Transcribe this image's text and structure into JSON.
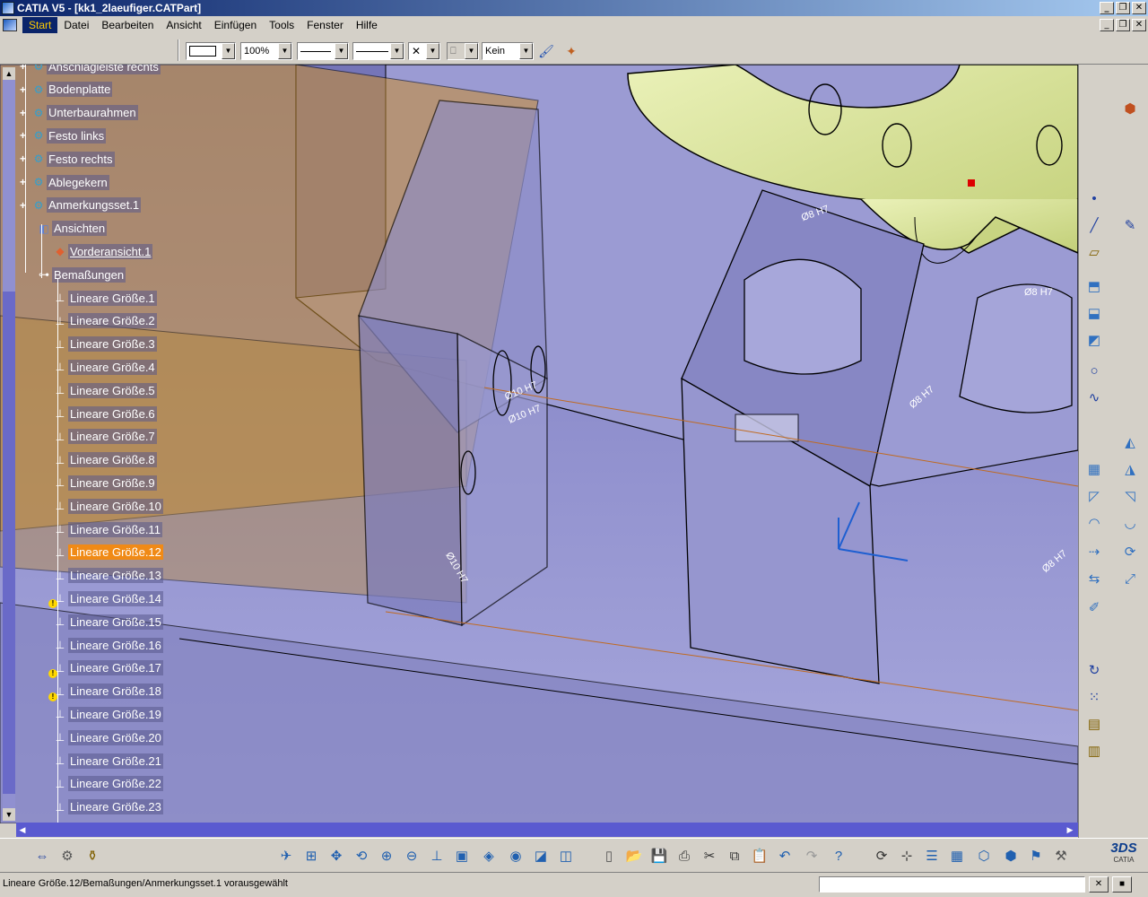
{
  "window": {
    "title": "CATIA V5 - [kk1_2laeufiger.CATPart]"
  },
  "menu": {
    "items": [
      "Start",
      "Datei",
      "Bearbeiten",
      "Ansicht",
      "Einfügen",
      "Tools",
      "Fenster",
      "Hilfe"
    ],
    "active_index": 0
  },
  "toolbar_top": {
    "zoom_value": "100%",
    "layer_value": "Kein"
  },
  "tree": {
    "items": [
      {
        "label": "Anschlagleiste rechts",
        "level": 1,
        "icon": "body-icon"
      },
      {
        "label": "Bodenplatte",
        "level": 1,
        "icon": "body-icon"
      },
      {
        "label": "Unterbaurahmen",
        "level": 1,
        "icon": "body-icon"
      },
      {
        "label": "Festo links",
        "level": 1,
        "icon": "body-icon"
      },
      {
        "label": "Festo rechts",
        "level": 1,
        "icon": "body-icon"
      },
      {
        "label": "Ablegekern",
        "level": 1,
        "icon": "body-icon"
      },
      {
        "label": "Anmerkungsset.1",
        "level": 1,
        "icon": "annotation-set-icon"
      },
      {
        "label": "Ansichten",
        "level": 2,
        "icon": "views-icon"
      },
      {
        "label": "Vorderansicht.1",
        "level": 3,
        "icon": "front-view-icon"
      },
      {
        "label": "Bemaßungen",
        "level": 2,
        "icon": "dimensions-icon"
      },
      {
        "label": "Lineare Größe.1",
        "level": 3,
        "icon": "linear-dimension-icon"
      },
      {
        "label": "Lineare Größe.2",
        "level": 3,
        "icon": "linear-dimension-icon"
      },
      {
        "label": "Lineare Größe.3",
        "level": 3,
        "icon": "linear-dimension-icon"
      },
      {
        "label": "Lineare Größe.4",
        "level": 3,
        "icon": "linear-dimension-icon"
      },
      {
        "label": "Lineare Größe.5",
        "level": 3,
        "icon": "linear-dimension-icon"
      },
      {
        "label": "Lineare Größe.6",
        "level": 3,
        "icon": "linear-dimension-icon"
      },
      {
        "label": "Lineare Größe.7",
        "level": 3,
        "icon": "linear-dimension-icon"
      },
      {
        "label": "Lineare Größe.8",
        "level": 3,
        "icon": "linear-dimension-icon"
      },
      {
        "label": "Lineare Größe.9",
        "level": 3,
        "icon": "linear-dimension-icon"
      },
      {
        "label": "Lineare Größe.10",
        "level": 3,
        "icon": "linear-dimension-icon"
      },
      {
        "label": "Lineare Größe.11",
        "level": 3,
        "icon": "linear-dimension-icon"
      },
      {
        "label": "Lineare Größe.12",
        "level": 3,
        "icon": "linear-dimension-icon",
        "selected": true
      },
      {
        "label": "Lineare Größe.13",
        "level": 3,
        "icon": "linear-dimension-icon"
      },
      {
        "label": "Lineare Größe.14",
        "level": 3,
        "icon": "linear-dimension-warning-icon"
      },
      {
        "label": "Lineare Größe.15",
        "level": 3,
        "icon": "linear-dimension-icon"
      },
      {
        "label": "Lineare Größe.16",
        "level": 3,
        "icon": "linear-dimension-icon"
      },
      {
        "label": "Lineare Größe.17",
        "level": 3,
        "icon": "linear-dimension-warning-icon"
      },
      {
        "label": "Lineare Größe.18",
        "level": 3,
        "icon": "linear-dimension-warning-icon"
      },
      {
        "label": "Lineare Größe.19",
        "level": 3,
        "icon": "linear-dimension-icon"
      },
      {
        "label": "Lineare Größe.20",
        "level": 3,
        "icon": "linear-dimension-icon"
      },
      {
        "label": "Lineare Größe.21",
        "level": 3,
        "icon": "linear-dimension-icon"
      },
      {
        "label": "Lineare Größe.22",
        "level": 3,
        "icon": "linear-dimension-icon"
      },
      {
        "label": "Lineare Größe.23",
        "level": 3,
        "icon": "linear-dimension-icon"
      }
    ]
  },
  "annotations": {
    "dim_a": "Ø10 H7",
    "dim_b": "Ø10 H7",
    "dim_c": "Ø8 H7",
    "dim_d": "Ø8 H7",
    "dim_e": "Ø8 H7",
    "dim_f": "Ø10 H7",
    "dim_g": "Ø8 H7"
  },
  "status": {
    "text": "Lineare Größe.12/Bemaßungen/Anmerkungsset.1 vorausgewählt"
  },
  "brand": {
    "logo_text": "CATIA"
  },
  "colors": {
    "selection": "#f08a16",
    "title_gradient_start": "#0a246a",
    "viewport_bg": "#8c8ccb",
    "part_green": "#d6e39a"
  }
}
